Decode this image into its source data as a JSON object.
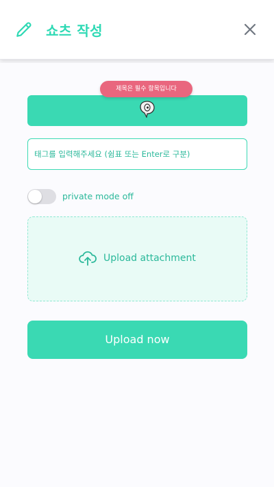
{
  "header": {
    "title": "쇼츠 작성",
    "edit_icon": "pencil-icon",
    "close_icon": "close-icon"
  },
  "form": {
    "title_tooltip": "제목은 필수 항목입니다",
    "title_value": "",
    "tag_placeholder": "태그를 입력해주세요 (쉼표 또는 Enter로 구분)",
    "privacy_toggle": {
      "label": "private mode off",
      "checked": false
    },
    "upload": {
      "icon": "cloud-upload-icon",
      "label": "Upload attachment"
    },
    "submit_label": "Upload now"
  },
  "colors": {
    "accent": "#3ad9b3",
    "accent_text": "#2ab89a",
    "tooltip": "#e9667e",
    "upload_bg": "#e9fbf6"
  }
}
